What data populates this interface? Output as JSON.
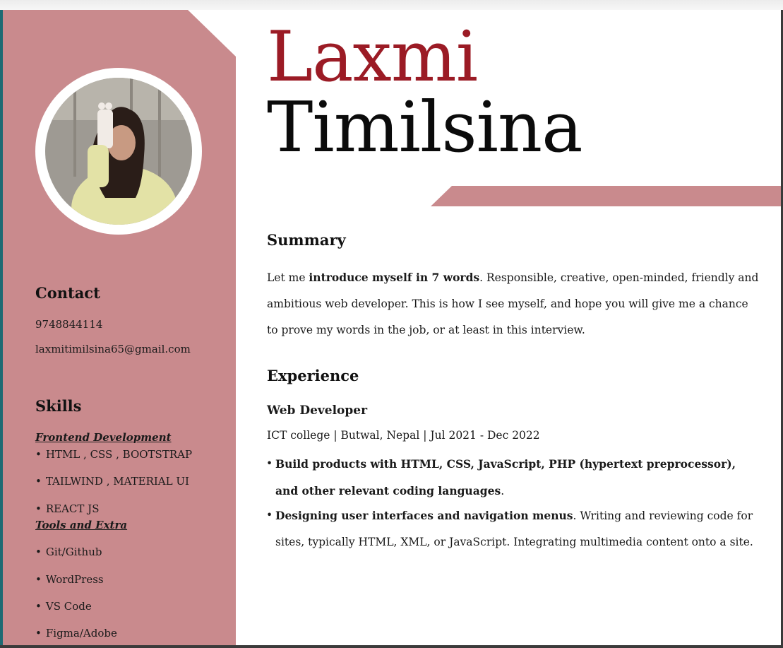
{
  "colors": {
    "accent": "#c98a8d",
    "first_name_color": "#9b1b25"
  },
  "name": {
    "first": "Laxmi",
    "last": "Timilsina"
  },
  "contact": {
    "heading": "Contact",
    "phone": "9748844114",
    "email": "laxmitimilsina65@gmail.com"
  },
  "skills": {
    "heading": "Skills",
    "frontend_heading": "Frontend Development",
    "frontend_items": [
      "HTML , CSS , BOOTSTRAP",
      "TAILWIND , MATERIAL UI",
      "REACT JS"
    ],
    "tools_heading": "Tools and Extra",
    "tools_items": [
      "Git/Github",
      "WordPress",
      "VS Code",
      "Figma/Adobe"
    ]
  },
  "summary": {
    "heading": "Summary",
    "intro": "Let me ",
    "intro_bold": "introduce myself in 7 words",
    "text": ". Responsible, creative, open-minded, friendly and ambitious web developer. This is how I see myself, and hope you will give me a chance to prove my words in the job, or at least in this interview."
  },
  "experience": {
    "heading": "Experience",
    "job_title": "Web Developer",
    "meta": "ICT college | Butwal, Nepal | Jul 2021 - Dec 2022",
    "bullets": [
      {
        "bold": "Build products with HTML, CSS, JavaScript, PHP (hypertext preprocessor), and other relevant coding languages",
        "text": "."
      },
      {
        "bold": "Designing user interfaces and navigation menus",
        "text": ". Writing and reviewing code for sites, typically HTML, XML, or JavaScript. Integrating multimedia content onto a site."
      }
    ]
  }
}
